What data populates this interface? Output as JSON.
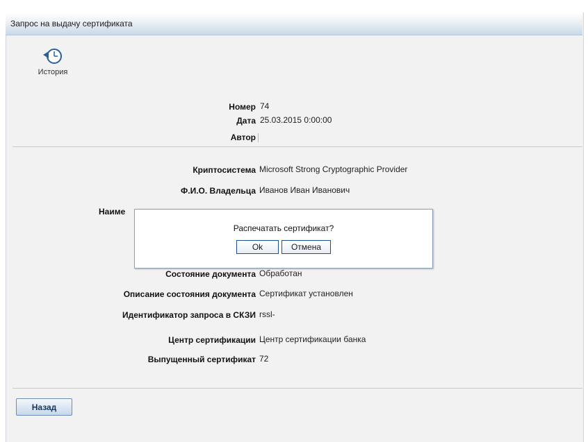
{
  "window": {
    "title": "Запрос на выдачу сертификата"
  },
  "toolbar": {
    "history_label": "История"
  },
  "header_fields": {
    "number_label": "Номер",
    "number_value": "74",
    "date_label": "Дата",
    "date_value": "25.03.2015 0:00:00",
    "author_label": "Автор",
    "author_value": ""
  },
  "fields": {
    "crypto_label": "Криптосистема",
    "crypto_value": "Microsoft Strong Cryptographic Provider",
    "owner_label": "Ф.И.О. Владельца",
    "owner_value": "Иванов Иван Иванович",
    "name_label_partial": "Наиме",
    "doc_state_label": "Состояние документа",
    "doc_state_value": "Обработан",
    "doc_state_desc_label": "Описание состояния документа",
    "doc_state_desc_value": "Сертификат установлен",
    "request_id_label": "Идентификатор запроса в СКЗИ",
    "request_id_value": "rssl-",
    "ca_label": "Центр сертификации",
    "ca_value": "Центр сертификации банка",
    "issued_cert_label": "Выпущенный сертификат",
    "issued_cert_value": "72"
  },
  "footer": {
    "back_label": "Назад"
  },
  "dialog": {
    "message": "Распечатать сертификат?",
    "ok_label": "Ok",
    "cancel_label": "Отмена"
  },
  "icons": {
    "history": "history-clock-icon"
  },
  "colors": {
    "titlebar": "#c9d9e8",
    "button_border": "#1b4f8a",
    "background": "#f2f2f2"
  }
}
